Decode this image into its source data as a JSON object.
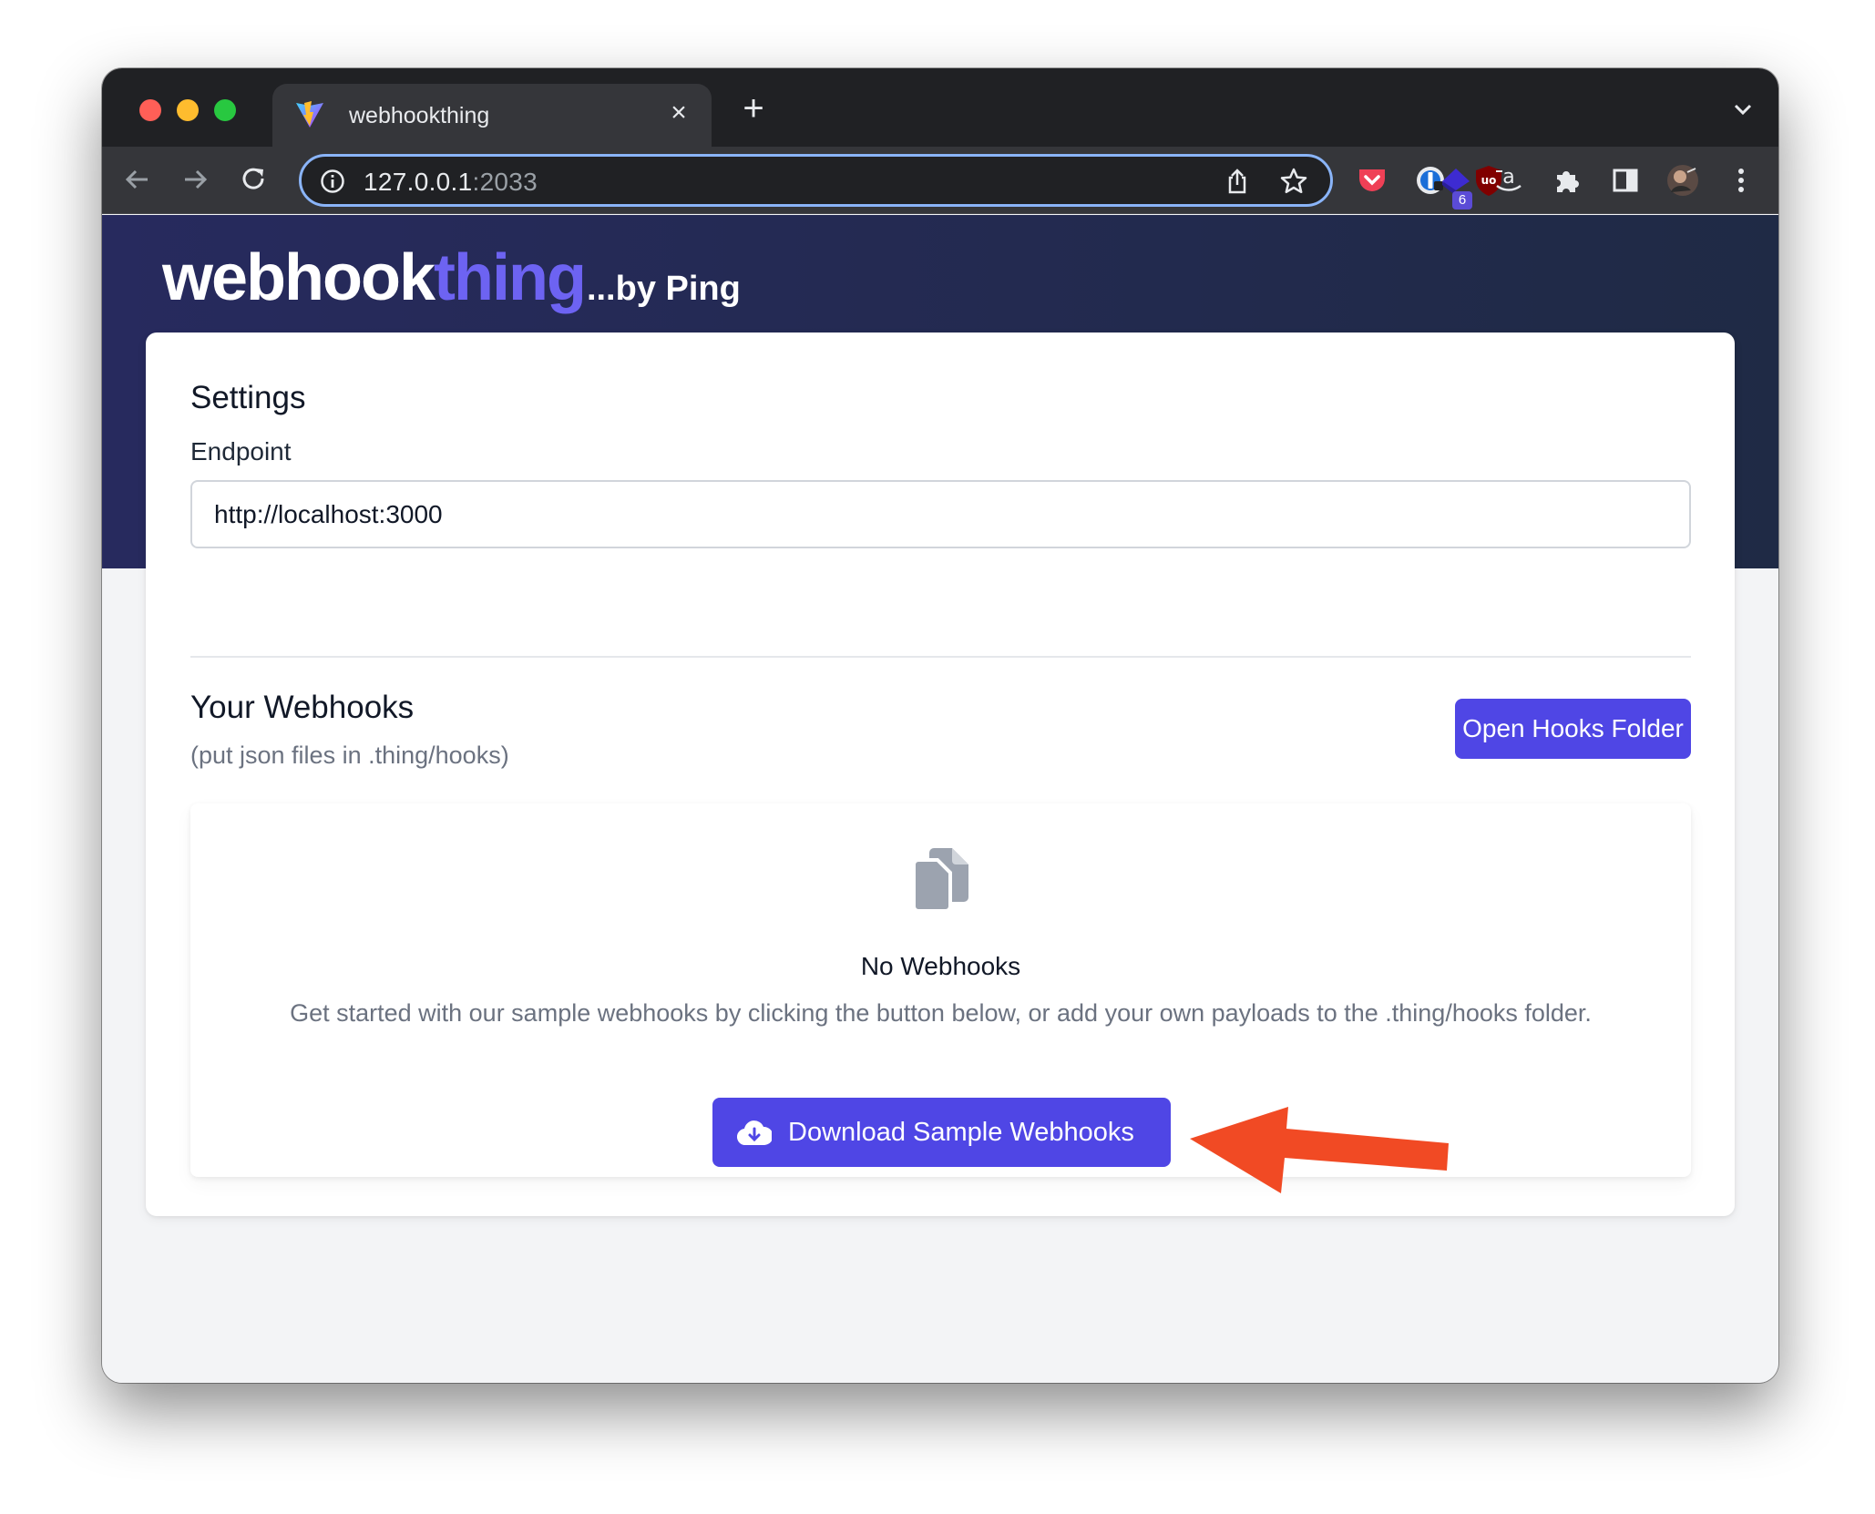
{
  "browser": {
    "tab_title": "webhookthing",
    "tab_close": "×",
    "new_tab": "+",
    "url_host": "127.0.0.1",
    "url_port": ":2033",
    "extension_badge": "6",
    "icons": [
      "back-icon",
      "forward-icon",
      "reload-icon",
      "info-icon",
      "share-icon",
      "star-icon",
      "pocket-icon",
      "onepassword-icon",
      "ublock-icon",
      "extension-icon",
      "amazon-icon",
      "puzzle-icon",
      "sidepanel-icon",
      "avatar",
      "menu-icon"
    ]
  },
  "header": {
    "logo_main": "webhook",
    "logo_accent": "thing",
    "logo_by": "...by Ping",
    "accent_color": "#6d63f2"
  },
  "settings": {
    "title": "Settings",
    "endpoint_label": "Endpoint",
    "endpoint_value": "http://localhost:3000"
  },
  "webhooks": {
    "title": "Your Webhooks",
    "subtitle": "(put json files in .thing/hooks)",
    "open_folder_label": "Open Hooks Folder",
    "empty_title": "No Webhooks",
    "empty_description": "Get started with our sample webhooks by clicking the button below, or add your own payloads to the .thing/hooks folder.",
    "download_label": "Download Sample Webhooks",
    "button_color": "#4f46e5"
  },
  "annotation": {
    "arrow_color": "#f14a24"
  }
}
